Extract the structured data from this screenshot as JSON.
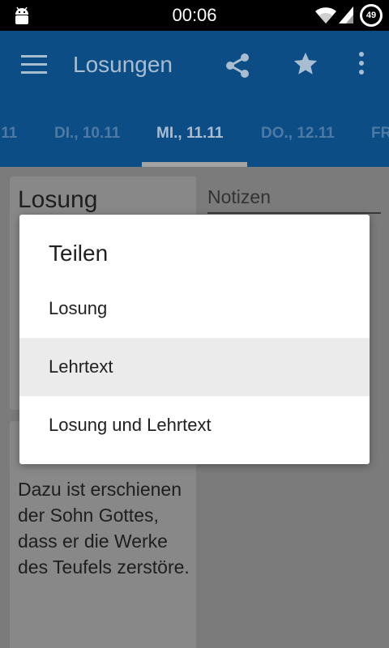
{
  "status_bar": {
    "time": "00:06",
    "battery": "49"
  },
  "app_bar": {
    "title": "Losungen"
  },
  "tabs": [
    {
      "label": ".11"
    },
    {
      "label": "DI., 10.11"
    },
    {
      "label": "MI., 11.11",
      "active": true
    },
    {
      "label": "DO., 12.11"
    },
    {
      "label": "FR"
    }
  ],
  "content": {
    "losung_heading": "Losung",
    "lehrtext_text": "Dazu ist erschienen der Sohn Gottes, dass er die Werke des Teufels zerstöre.",
    "notes_placeholder": "Notizen"
  },
  "dialog": {
    "title": "Teilen",
    "options": [
      "Losung",
      "Lehrtext",
      "Losung und Lehrtext"
    ]
  },
  "colors": {
    "primary": "#0d4d86",
    "dim_overlay": "#7b7b7b",
    "dialog": "#ffffff"
  }
}
